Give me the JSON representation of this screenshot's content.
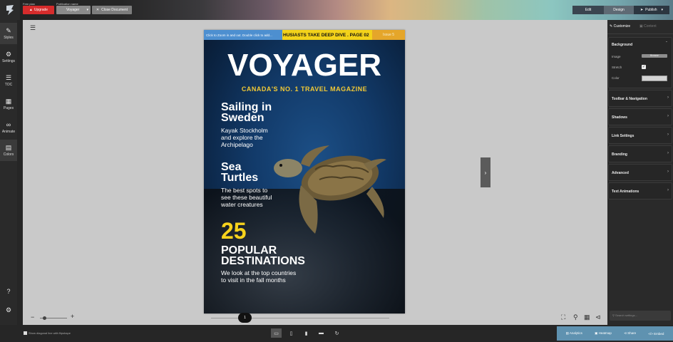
{
  "topbar": {
    "brand_vertical": "flipsnack",
    "plan_label": "Free plan",
    "upgrade_label": "Upgrade",
    "publication_label": "Publication name",
    "publication_value": "Voyager",
    "close_label": "Close Document",
    "mode_edit": "Edit",
    "mode_design": "Design",
    "publish_label": "Publish"
  },
  "leftbar": {
    "items": [
      {
        "label": "Styles",
        "icon": "paintbrush-icon",
        "glyph": "🖌"
      },
      {
        "label": "Settings",
        "icon": "gear-icon",
        "glyph": "⚙"
      },
      {
        "label": "TOC",
        "icon": "list-icon",
        "glyph": "☰"
      },
      {
        "label": "Pages",
        "icon": "grid-icon",
        "glyph": "⊞"
      },
      {
        "label": "Animate",
        "icon": "link-icon",
        "glyph": "∞"
      },
      {
        "label": "Colors",
        "icon": "palette-icon",
        "glyph": "▤"
      }
    ],
    "help_glyph": "?",
    "settings_glyph": "⚙"
  },
  "cover": {
    "hint": "Click to Zoom in and out. Double click to add...",
    "ticker": "HUSIASTS TAKE DEEP DIVE . PAGE 02",
    "badge": "Issue 5",
    "masthead": "VOYAGER",
    "tagline": "CANADA'S NO. 1 TRAVEL MAGAZINE",
    "story1_title_1": "Sailing in",
    "story1_title_2": "Sweden",
    "story1_body_1": "Kayak Stockholm",
    "story1_body_2": "and explore the",
    "story1_body_3": "Archipelago",
    "story2_title_1": "Sea",
    "story2_title_2": "Turtles",
    "story2_body_1": "The best spots to",
    "story2_body_2": "see these beautiful",
    "story2_body_3": "water creatures",
    "feature_number": "25",
    "feature_title_1": "POPULAR",
    "feature_title_2": "DESTINATIONS",
    "feature_body_1": "We look at the top countries",
    "feature_body_2": "to visit in the fall months"
  },
  "canvas": {
    "zoom_minus": "−",
    "zoom_plus": "+",
    "zoom_level": 0.15,
    "page_number": "1",
    "next_glyph": "›"
  },
  "rpanel": {
    "tab_customize": "Customize",
    "tab_content": "Content",
    "background_title": "Background",
    "image_label": "Image",
    "browse_label": "Browse",
    "stretch_label": "Stretch",
    "stretch_checked": true,
    "color_label": "Color",
    "color_value": "#d4d4d4",
    "sections": [
      "Toolbar & Navigation",
      "Shadows",
      "Link Settings",
      "Branding",
      "Advanced",
      "Text Animations"
    ],
    "search_placeholder": "Search settings..."
  },
  "bottombar": {
    "rtl_label": "Show diagonal line with flipshape",
    "analytics": "Analytics",
    "heatmap": "Heatmap",
    "share": "Share",
    "embed": "Embed"
  },
  "colors": {
    "upgrade": "#d62c2c",
    "ticker": "#f3d21a",
    "tagline": "#f2c935",
    "feature_number": "#f6d21c",
    "actions_bar": "#5f92b0"
  }
}
